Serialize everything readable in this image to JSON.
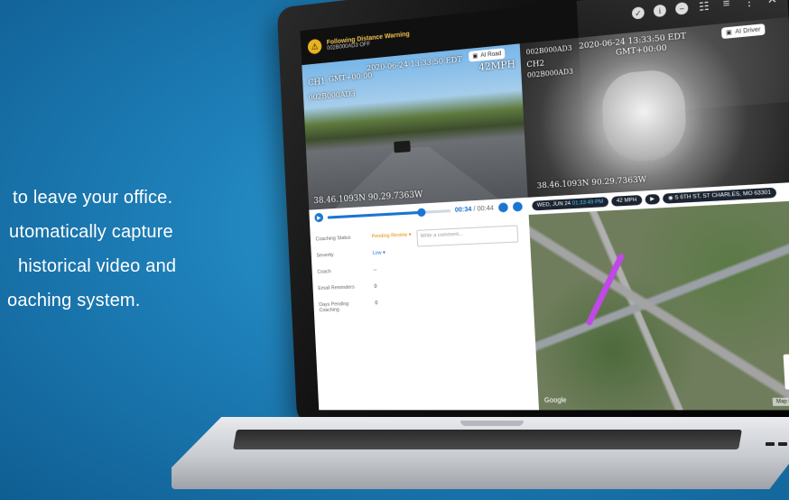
{
  "marketing": {
    "lines": [
      "to leave your office.",
      "utomatically capture",
      "historical video and",
      "oaching system."
    ]
  },
  "topbar": {
    "alert_title": "Following Distance Warning",
    "alert_subtitle": "002B000AD3  OFF"
  },
  "cam_road": {
    "timestamp": "2020-06-24 13:33:50 EDT",
    "channel": "CH1",
    "timezone": "GMT+00:00",
    "device_id": "002B000AD3",
    "speed": "42MPH",
    "coords": "38.46.1093N 90.29.7363W",
    "button": "AI Road"
  },
  "cam_driver": {
    "timestamp": "2020-06-24 13:33:50 EDT",
    "device_id": "002B000AD3",
    "channel": "CH2",
    "timezone": "GMT+00:00",
    "coords": "38.46.1093N 90.29.7363W",
    "button": "AI Driver"
  },
  "player": {
    "current_time": "00:34",
    "total_time": "00:44",
    "progress": 0.77
  },
  "info": {
    "date": "WED, JUN 24",
    "time": "01:33:49 PM",
    "speed": "42 MPH",
    "address": "S 6TH ST, ST CHARLES, MO 63301"
  },
  "coaching": {
    "rows": [
      {
        "label": "Coaching Status",
        "value": "Pending Review ▾",
        "tone": "orange"
      },
      {
        "label": "Severity",
        "value": "Low ▾",
        "tone": "blue"
      },
      {
        "label": "Coach",
        "value": "--",
        "tone": ""
      },
      {
        "label": "Email Reminders",
        "value": "0",
        "tone": ""
      },
      {
        "label": "Days Pending Coaching",
        "value": "0",
        "tone": ""
      }
    ],
    "comment_placeholder": "Write a comment..."
  },
  "map": {
    "brand": "Google",
    "terms": "Map Data",
    "zoom_in": "+",
    "zoom_out": "−"
  },
  "colors": {
    "accent": "#1976d2",
    "warning": "#e8b321",
    "background": "#1e7fb8"
  }
}
